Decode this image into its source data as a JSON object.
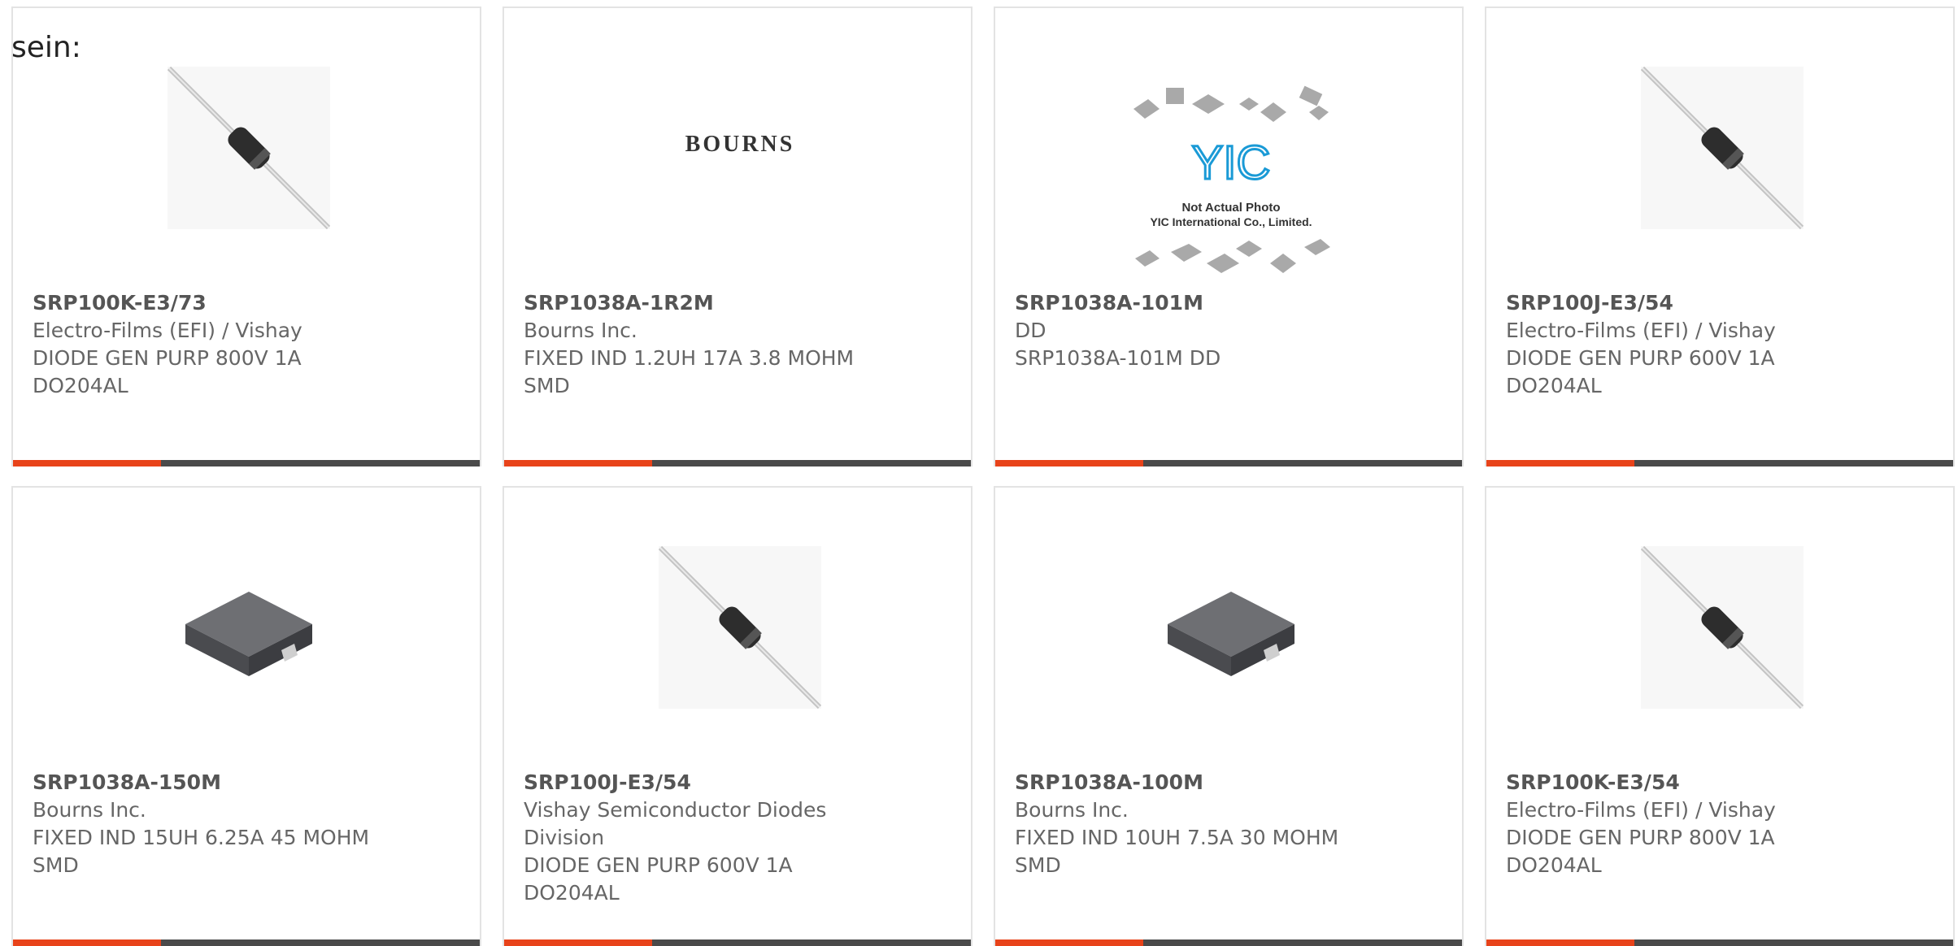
{
  "overlay_label": "sein:",
  "colors": {
    "accent": "#e8431a",
    "bar": "#4a4a4a",
    "border": "#e3e3e3"
  },
  "cards": [
    {
      "pn": "SRP100K-E3/73",
      "maker": "Electro-Films (EFI) / Vishay",
      "desc": [
        "DIODE GEN PURP 800V 1A",
        "DO204AL"
      ],
      "image": "axial-diode-photo"
    },
    {
      "pn": "SRP1038A-1R2M",
      "maker": "Bourns Inc.",
      "desc": [
        "FIXED IND 1.2UH 17A 3.8 MOHM",
        "SMD"
      ],
      "image": "bourns-logo",
      "logo_text": "BOURNS"
    },
    {
      "pn": "SRP1038A-101M",
      "maker": "DD",
      "desc": [
        "SRP1038A-101M DD"
      ],
      "image": "not-actual-photo",
      "logo_text": "YIC",
      "caption1": "Not Actual Photo",
      "caption2": "YIC International Co., Limited."
    },
    {
      "pn": "SRP100J-E3/54",
      "maker": "Electro-Films (EFI) / Vishay",
      "desc": [
        "DIODE GEN PURP 600V 1A",
        "DO204AL"
      ],
      "image": "axial-diode-photo"
    },
    {
      "pn": "SRP1038A-150M",
      "maker": "Bourns Inc.",
      "desc": [
        "FIXED IND 15UH 6.25A 45 MOHM",
        "SMD"
      ],
      "image": "smd-inductor-photo"
    },
    {
      "pn": "SRP100J-E3/54",
      "maker": "Vishay Semiconductor Diodes",
      "maker2": "Division",
      "desc": [
        "DIODE GEN PURP 600V 1A",
        "DO204AL"
      ],
      "image": "axial-diode-photo"
    },
    {
      "pn": "SRP1038A-100M",
      "maker": "Bourns Inc.",
      "desc": [
        "FIXED IND 10UH 7.5A 30 MOHM",
        "SMD"
      ],
      "image": "smd-inductor-photo"
    },
    {
      "pn": "SRP100K-E3/54",
      "maker": "Electro-Films (EFI) / Vishay",
      "desc": [
        "DIODE GEN PURP 800V 1A",
        "DO204AL"
      ],
      "image": "axial-diode-photo"
    }
  ]
}
